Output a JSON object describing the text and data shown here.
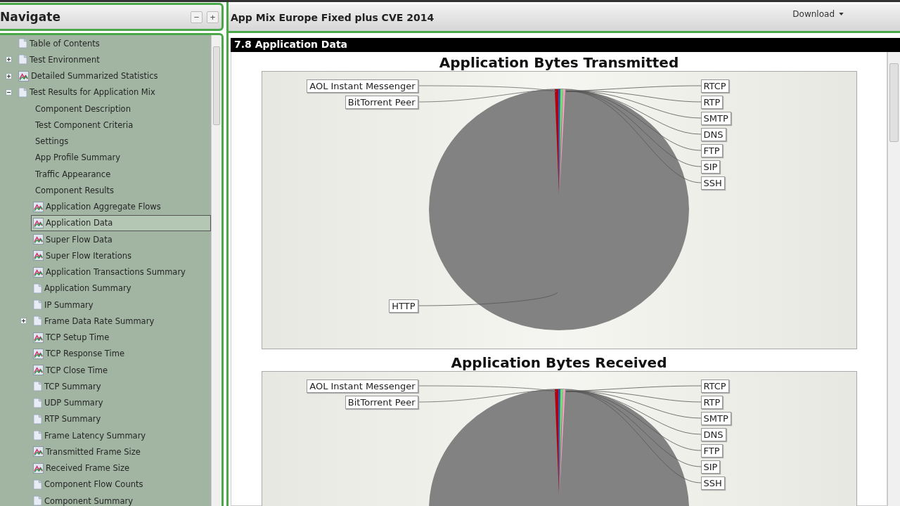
{
  "navigate": {
    "title": "Navigate",
    "collapse_all": "−",
    "expand_all": "+",
    "tree": [
      {
        "label": "Table of Contents",
        "kind": "doc",
        "selected": false
      },
      {
        "label": "Test Environment",
        "kind": "doc",
        "expanded": false,
        "selected": false
      },
      {
        "label": "Detailed Summarized Statistics",
        "kind": "chart",
        "expanded": false,
        "selected": false
      },
      {
        "label": "Test Results for Application Mix",
        "kind": "doc",
        "expanded": true,
        "selected": false,
        "children": [
          {
            "label": "Component Description",
            "kind": "plain",
            "selected": false
          },
          {
            "label": "Test Component Criteria",
            "kind": "plain",
            "selected": false
          },
          {
            "label": "Settings",
            "kind": "plain",
            "selected": false
          },
          {
            "label": "App Profile Summary",
            "kind": "plain",
            "selected": false
          },
          {
            "label": "Traffic Appearance",
            "kind": "plain",
            "selected": false
          },
          {
            "label": "Component Results",
            "kind": "plain",
            "selected": false
          },
          {
            "label": "Application Aggregate Flows",
            "kind": "chart",
            "selected": false
          },
          {
            "label": "Application Data",
            "kind": "chart",
            "selected": true
          },
          {
            "label": "Super Flow Data",
            "kind": "chart",
            "selected": false
          },
          {
            "label": "Super Flow Iterations",
            "kind": "chart",
            "selected": false
          },
          {
            "label": "Application Transactions Summary",
            "kind": "chart",
            "selected": false
          },
          {
            "label": "Application Summary",
            "kind": "doc",
            "selected": false
          },
          {
            "label": "IP Summary",
            "kind": "doc",
            "selected": false
          },
          {
            "label": "Frame Data Rate Summary",
            "kind": "doc",
            "expanded": false,
            "selected": false
          },
          {
            "label": "TCP Setup Time",
            "kind": "chart",
            "selected": false
          },
          {
            "label": "TCP Response Time",
            "kind": "chart",
            "selected": false
          },
          {
            "label": "TCP Close Time",
            "kind": "chart",
            "selected": false
          },
          {
            "label": "TCP Summary",
            "kind": "doc",
            "selected": false
          },
          {
            "label": "UDP Summary",
            "kind": "doc",
            "selected": false
          },
          {
            "label": "RTP Summary",
            "kind": "doc",
            "selected": false
          },
          {
            "label": "Frame Latency Summary",
            "kind": "doc",
            "selected": false
          },
          {
            "label": "Transmitted Frame Size",
            "kind": "chart",
            "selected": false
          },
          {
            "label": "Received Frame Size",
            "kind": "chart",
            "selected": false
          },
          {
            "label": "Component Flow Counts",
            "kind": "doc",
            "selected": false
          },
          {
            "label": "Component Summary",
            "kind": "doc",
            "selected": false
          }
        ]
      }
    ]
  },
  "report": {
    "title": "App Mix Europe Fixed plus CVE 2014",
    "download": "Download",
    "section": "7.8 Application Data",
    "charts": [
      {
        "title": "Application Bytes Transmitted",
        "left_labels": [
          "AOL Instant Messenger",
          "BitTorrent Peer"
        ],
        "right_labels": [
          "RTCP",
          "RTP",
          "SMTP",
          "DNS",
          "FTP",
          "SIP",
          "SSH"
        ],
        "bottom_label": "HTTP"
      },
      {
        "title": "Application Bytes Received",
        "left_labels": [
          "AOL Instant Messenger",
          "BitTorrent Peer"
        ],
        "right_labels": [
          "RTCP",
          "RTP",
          "SMTP",
          "DNS",
          "FTP",
          "SIP",
          "SSH"
        ]
      }
    ]
  }
}
